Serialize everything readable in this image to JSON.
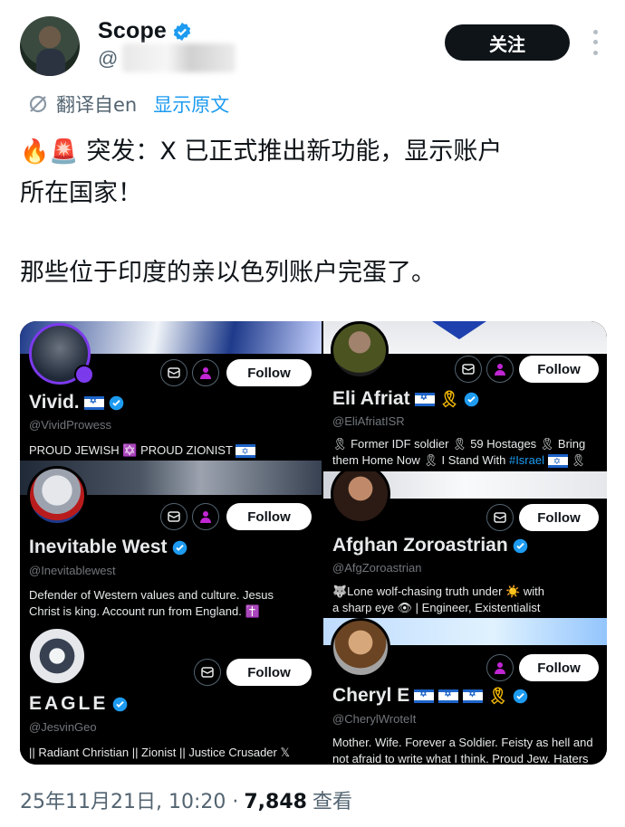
{
  "author": {
    "display_name": "Scope",
    "handle": "@",
    "follow_label": "关注"
  },
  "translation": {
    "label": "翻译自en",
    "show_original": "显示原文"
  },
  "tweet": {
    "line1_emoji": "🔥🚨",
    "line1_text": "突发：X 已正式推出新功能，显示账户",
    "line2_text": "所在国家！",
    "line3_text": "那些位于印度的亲以色列账户完蛋了。"
  },
  "cards": [
    {
      "name": "Vivid.",
      "handle": "@VividProwess",
      "bio1": "PROUD JEWISH ✡️ PROUD ZIONIST",
      "follow": "Follow"
    },
    {
      "name": "Eli Afriat",
      "handle": "@EliAfriatISR",
      "bio1": "🎗 Former IDF soldier 🎗 59 Hostages 🎗 Bring",
      "bio2a": "them Home Now 🎗 I Stand With ",
      "bio2_tag": "#Israel",
      "bio2b": " 🎗",
      "follow": "Follow"
    },
    {
      "name": "Inevitable West",
      "handle": "@Inevitablewest",
      "bio1": "Defender of Western values and culture. Jesus",
      "bio2": "Christ is king. Account run from England. ✝️",
      "follow": "Follow"
    },
    {
      "name": "Afghan Zoroastrian",
      "handle": "@AfgZoroastrian",
      "bio1": "🐺Lone wolf-chasing truth under ☀️ with",
      "bio2": "a sharp eye 👁 | Engineer, Existentialist",
      "follow": "Follow"
    },
    {
      "name": "EAGLE",
      "handle": "@JesvinGeo",
      "bio1": "|| Radiant Christian || Zionist || Justice Crusader 𝕏",
      "follow": "Follow"
    },
    {
      "name": "Cheryl E",
      "handle": "@CherylWroteIt",
      "bio1": "Mother. Wife. Forever a Soldier. Feisty as hell and",
      "bio2": "not afraid to write what I think. Proud Jew. Haters",
      "follow": "Follow"
    }
  ],
  "footer": {
    "timestamp": "25年11月21日, 10:20 ·",
    "views": "7,848",
    "views_label": "查看"
  },
  "colors": {
    "accent": "#1d9bf0",
    "text": "#0f1419",
    "muted": "#536471",
    "card_bg": "#000000"
  }
}
